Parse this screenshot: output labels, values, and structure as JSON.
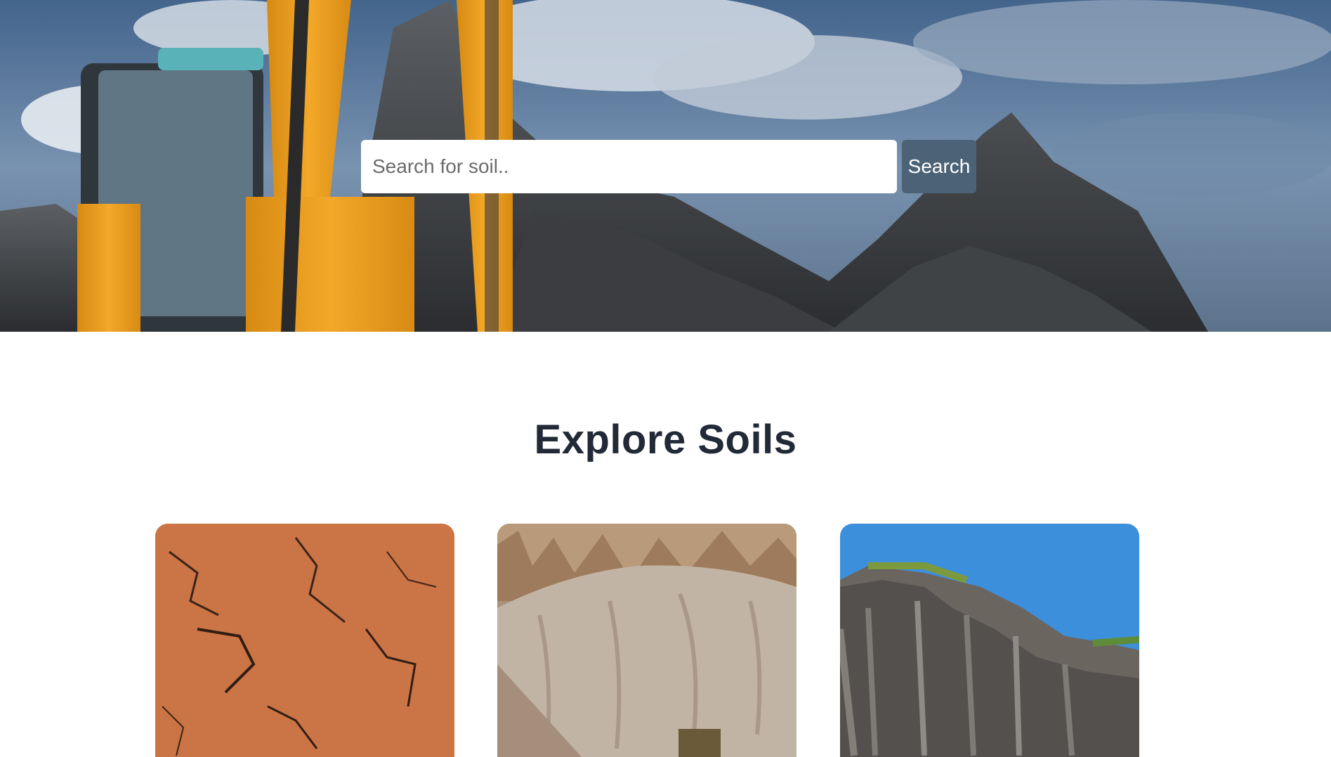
{
  "hero": {
    "search": {
      "placeholder": "Search for soil..",
      "value": ""
    },
    "search_button_label": "Search",
    "scene": "excavator in front of dark soil mountains under cloudy sky"
  },
  "explore": {
    "title": "Explore Soils",
    "cards": [
      {
        "image": "red laterite soil texture"
      },
      {
        "image": "sand pile in quarry"
      },
      {
        "image": "rocky cliff under blue sky"
      }
    ]
  },
  "colors": {
    "button_bg": "#4c6277",
    "title_text": "#222a38",
    "excavator": "#f0a020",
    "sky": "#5b7fa8"
  }
}
